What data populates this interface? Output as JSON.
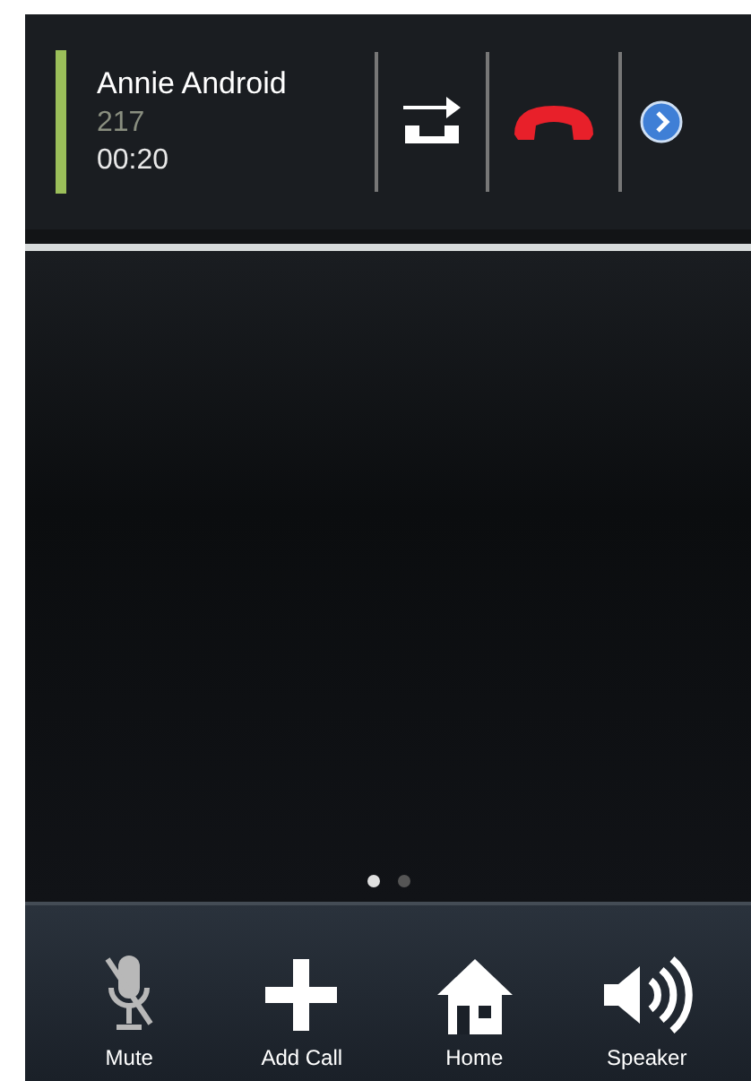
{
  "call": {
    "name": "Annie Android",
    "number": "217",
    "duration": "00:20",
    "color": "#9bbf5a"
  },
  "page_dots": [
    {
      "selected": true
    },
    {
      "selected": false
    }
  ],
  "toolbar": [
    {
      "kind": "mute",
      "label": "Mute"
    },
    {
      "kind": "add",
      "label": "Add Call"
    },
    {
      "kind": "home",
      "label": "Home"
    },
    {
      "kind": "speaker",
      "label": "Speaker"
    }
  ]
}
